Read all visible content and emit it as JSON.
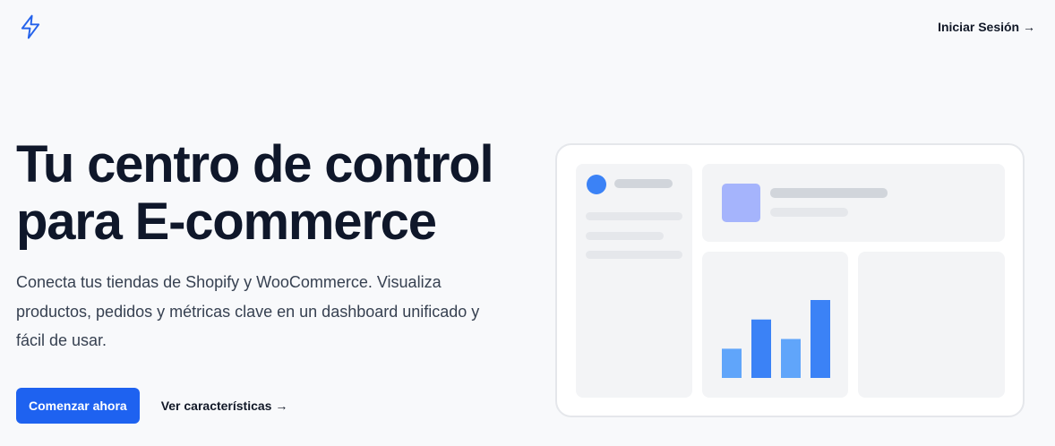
{
  "header": {
    "logo_icon": "lightning-bolt-icon",
    "login_label": "Iniciar Sesión →"
  },
  "hero": {
    "title_line1": "Tu centro de control",
    "title_line2": "para E-commerce",
    "subtitle": "Conecta tus tiendas de Shopify y WooCommerce. Visualiza productos, pedidos y métricas clave en un dashboard unificado y fácil de usar.",
    "primary_cta": "Comenzar ahora",
    "secondary_cta": "Ver características →"
  },
  "colors": {
    "primary": "#1e62f0",
    "accent_blue": "#3b82f6",
    "light_blue": "#60a5fa",
    "indigo_light": "#a5b4fc",
    "placeholder": "#e5e7eb",
    "card_bg": "#f3f4f6"
  },
  "mockup": {
    "bars": [
      {
        "value": 1.5,
        "color": "#60a5fa"
      },
      {
        "value": 3,
        "color": "#3b82f6"
      },
      {
        "value": 2,
        "color": "#60a5fa"
      },
      {
        "value": 4,
        "color": "#3b82f6"
      }
    ]
  }
}
